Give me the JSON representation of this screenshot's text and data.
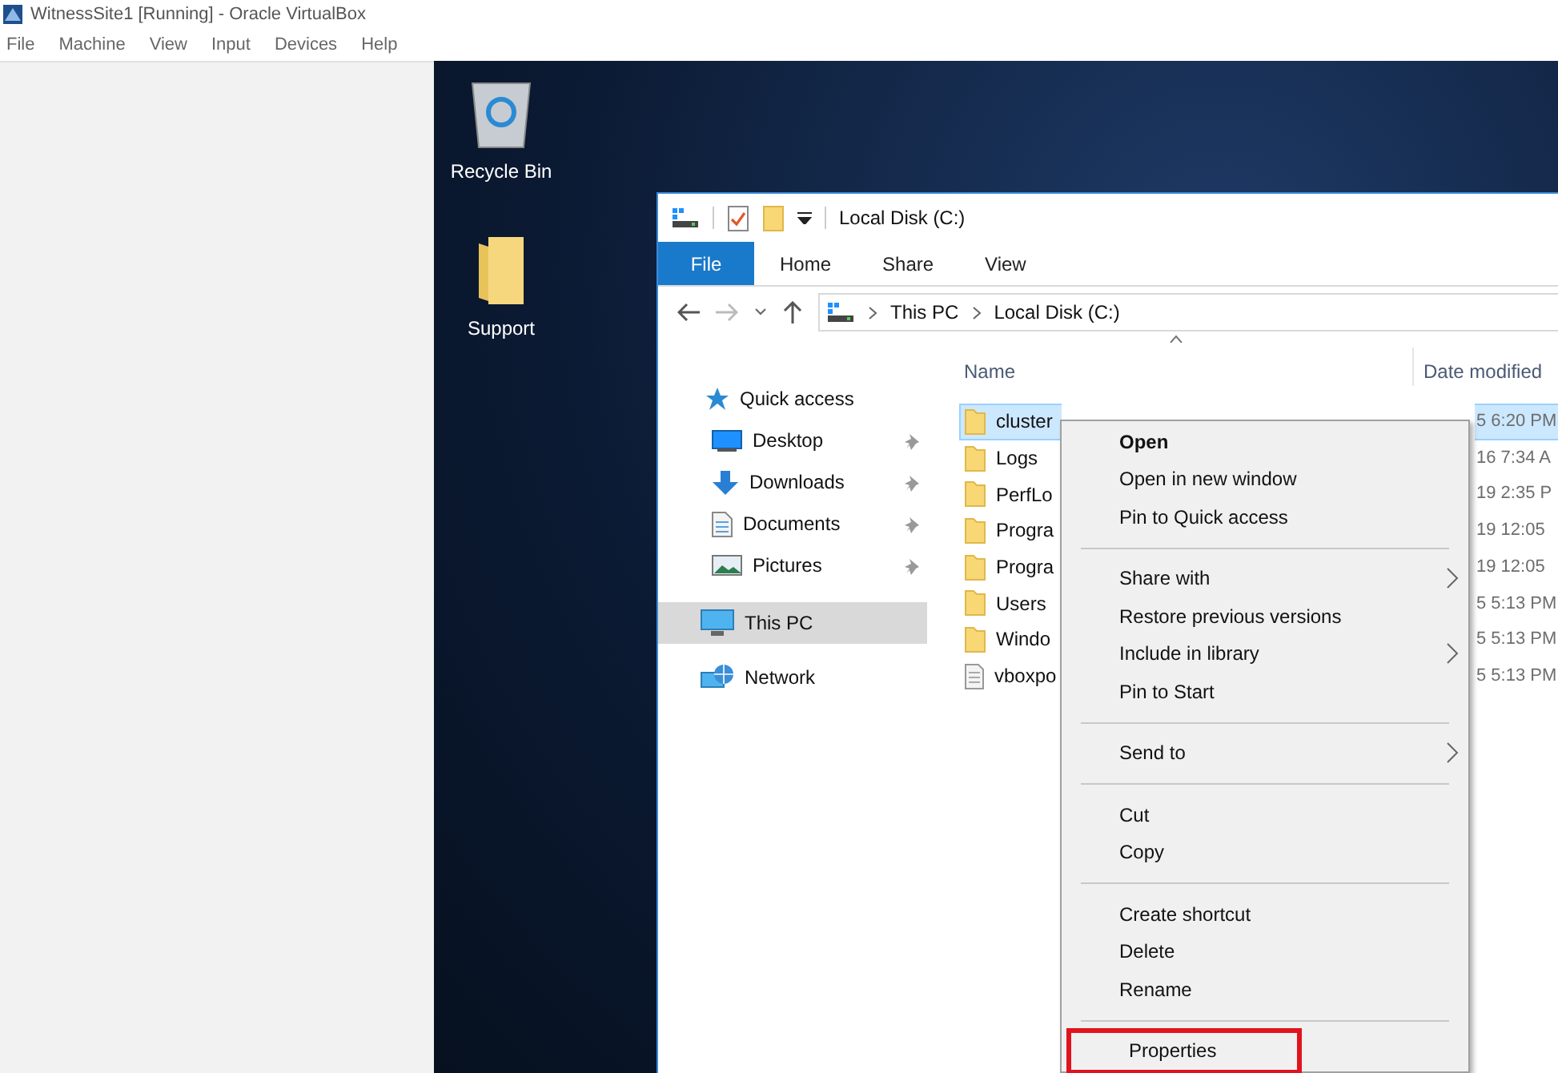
{
  "vbox": {
    "title": "WitnessSite1 [Running] - Oracle VirtualBox",
    "menu": [
      "File",
      "Machine",
      "View",
      "Input",
      "Devices",
      "Help"
    ]
  },
  "desktop": {
    "icons": [
      {
        "kind": "recycle-bin",
        "label": "Recycle Bin"
      },
      {
        "kind": "folder",
        "label": "Support"
      }
    ]
  },
  "explorer": {
    "title": "Local Disk (C:)",
    "ribbon_tabs": [
      {
        "label": "File",
        "selected": true
      },
      {
        "label": "Home",
        "selected": false
      },
      {
        "label": "Share",
        "selected": false
      },
      {
        "label": "View",
        "selected": false
      }
    ],
    "breadcrumb": [
      "This PC",
      "Local Disk (C:)"
    ],
    "columns": [
      "Name",
      "Date modified"
    ],
    "nav": [
      {
        "kind": "quick",
        "label": "Quick access",
        "selected": false,
        "children": [
          {
            "kind": "desktop",
            "label": "Desktop",
            "pinned": true,
            "selected": false
          },
          {
            "kind": "downloads",
            "label": "Downloads",
            "pinned": true,
            "selected": false
          },
          {
            "kind": "documents",
            "label": "Documents",
            "pinned": true,
            "selected": false
          },
          {
            "kind": "pictures",
            "label": "Pictures",
            "pinned": true,
            "selected": false
          }
        ]
      },
      {
        "kind": "pc",
        "label": "This PC",
        "selected": true
      },
      {
        "kind": "network",
        "label": "Network",
        "selected": false
      }
    ],
    "files": [
      {
        "kind": "folder",
        "name": "cluster",
        "modified": "5 6:20 PM",
        "selected": true
      },
      {
        "kind": "folder",
        "name": "Logs",
        "modified": "16 7:34 A",
        "selected": false
      },
      {
        "kind": "folder",
        "name": "PerfLo",
        "modified": "19 2:35 P",
        "selected": false
      },
      {
        "kind": "folder",
        "name": "Progra",
        "modified": "19 12:05",
        "selected": false
      },
      {
        "kind": "folder",
        "name": "Progra",
        "modified": "19 12:05",
        "selected": false
      },
      {
        "kind": "folder",
        "name": "Users",
        "modified": "5 5:13 PM",
        "selected": false
      },
      {
        "kind": "folder",
        "name": "Windo",
        "modified": "5 5:13 PM",
        "selected": false
      },
      {
        "kind": "file",
        "name": "vboxpo",
        "modified": "5 5:13 PM",
        "selected": false
      }
    ]
  },
  "context_menu": {
    "items": [
      {
        "kind": "item",
        "label": "Open",
        "default": true,
        "submenu": false,
        "highlighted": false
      },
      {
        "kind": "item",
        "label": "Open in new window",
        "default": false,
        "submenu": false,
        "highlighted": false
      },
      {
        "kind": "item",
        "label": "Pin to Quick access",
        "default": false,
        "submenu": false,
        "highlighted": false
      },
      {
        "kind": "separator"
      },
      {
        "kind": "item",
        "label": "Share with",
        "default": false,
        "submenu": true,
        "highlighted": false
      },
      {
        "kind": "item",
        "label": "Restore previous versions",
        "default": false,
        "submenu": false,
        "highlighted": false
      },
      {
        "kind": "item",
        "label": "Include in library",
        "default": false,
        "submenu": true,
        "highlighted": false
      },
      {
        "kind": "item",
        "label": "Pin to Start",
        "default": false,
        "submenu": false,
        "highlighted": false
      },
      {
        "kind": "separator"
      },
      {
        "kind": "item",
        "label": "Send to",
        "default": false,
        "submenu": true,
        "highlighted": false
      },
      {
        "kind": "separator"
      },
      {
        "kind": "item",
        "label": "Cut",
        "default": false,
        "submenu": false,
        "highlighted": false
      },
      {
        "kind": "item",
        "label": "Copy",
        "default": false,
        "submenu": false,
        "highlighted": false
      },
      {
        "kind": "separator"
      },
      {
        "kind": "item",
        "label": "Create shortcut",
        "default": false,
        "submenu": false,
        "highlighted": false
      },
      {
        "kind": "item",
        "label": "Delete",
        "default": false,
        "submenu": false,
        "highlighted": false
      },
      {
        "kind": "item",
        "label": "Rename",
        "default": false,
        "submenu": false,
        "highlighted": false
      },
      {
        "kind": "separator"
      },
      {
        "kind": "item",
        "label": "Properties",
        "default": false,
        "submenu": false,
        "highlighted": true
      }
    ]
  }
}
